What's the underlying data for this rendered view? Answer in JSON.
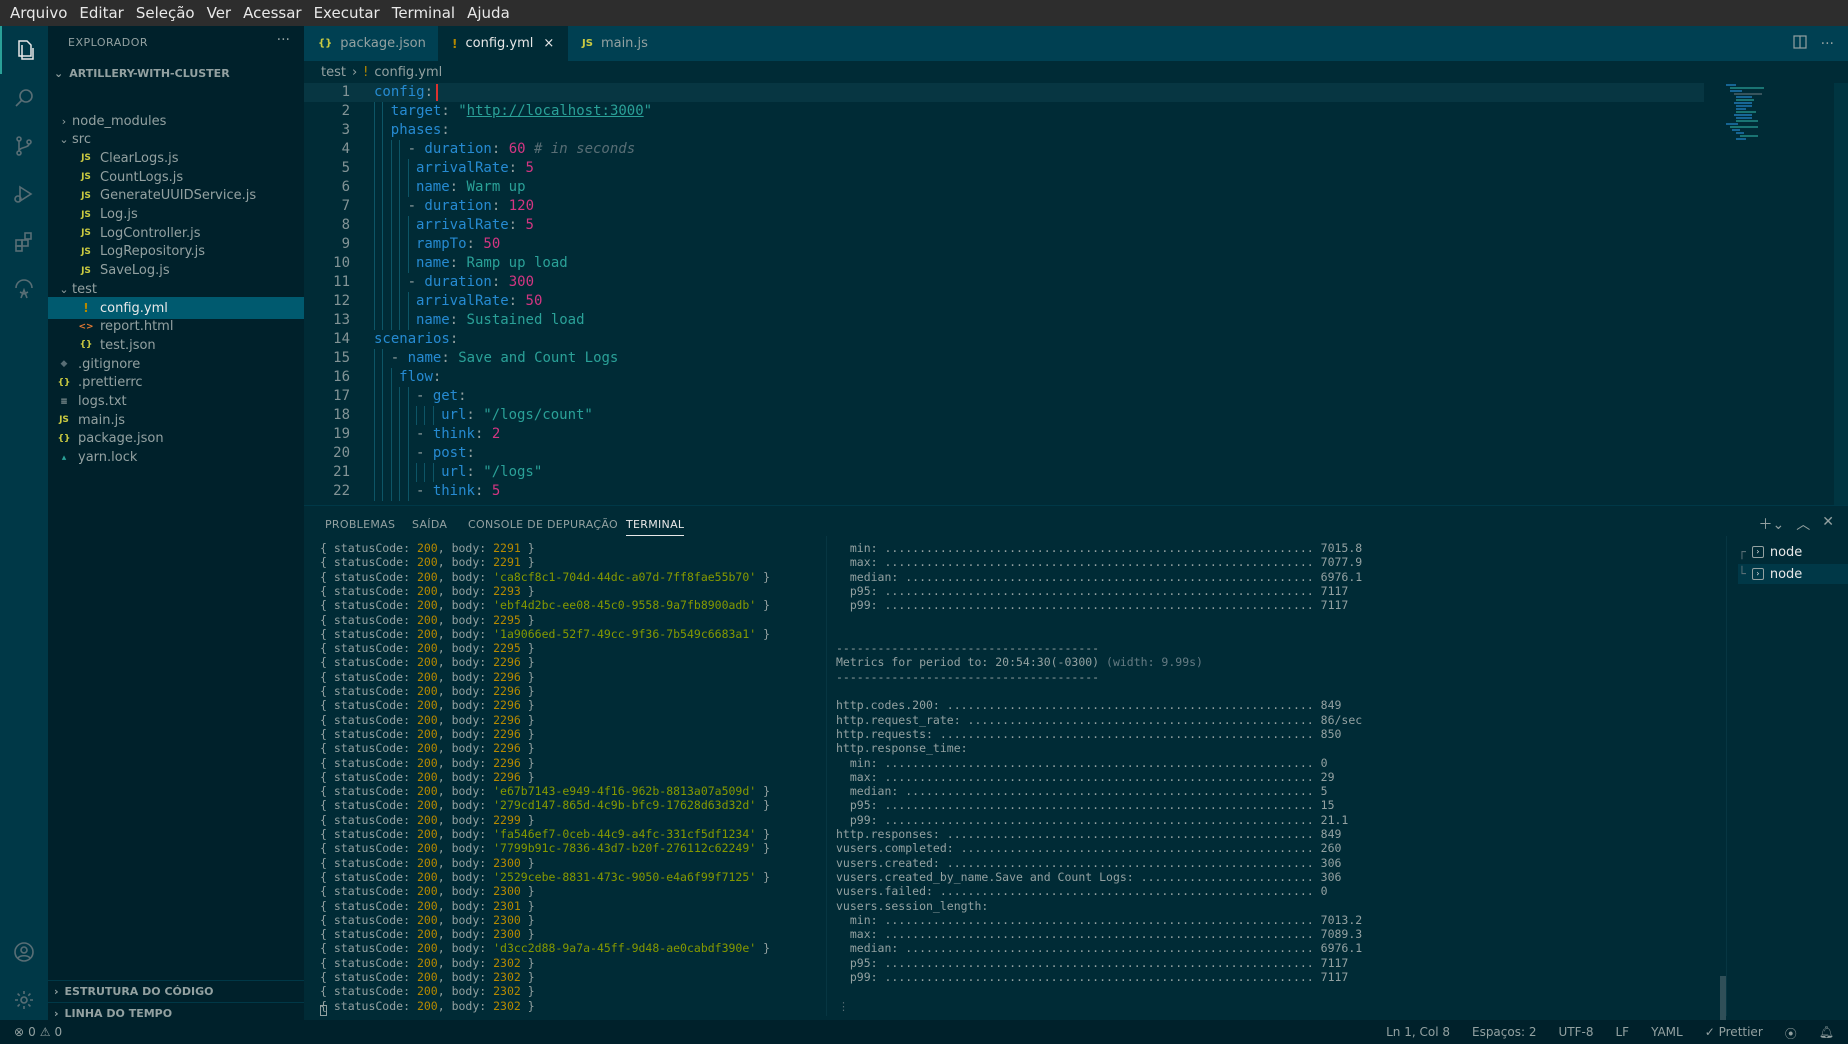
{
  "menu": [
    "Arquivo",
    "Editar",
    "Seleção",
    "Ver",
    "Acessar",
    "Executar",
    "Terminal",
    "Ajuda"
  ],
  "sidebar": {
    "title": "EXPLORADOR",
    "more": "···",
    "project": "ARTILLERY-WITH-CLUSTER",
    "tree": [
      {
        "label": "node_modules",
        "chev": "›",
        "icon": "",
        "cls": "",
        "indent": 1
      },
      {
        "label": "src",
        "chev": "⌄",
        "icon": "",
        "cls": "",
        "indent": 1
      },
      {
        "label": "ClearLogs.js",
        "chev": "",
        "icon": "JS",
        "cls": "fi-js",
        "indent": 2
      },
      {
        "label": "CountLogs.js",
        "chev": "",
        "icon": "JS",
        "cls": "fi-js",
        "indent": 2
      },
      {
        "label": "GenerateUUIDService.js",
        "chev": "",
        "icon": "JS",
        "cls": "fi-js",
        "indent": 2
      },
      {
        "label": "Log.js",
        "chev": "",
        "icon": "JS",
        "cls": "fi-js",
        "indent": 2
      },
      {
        "label": "LogController.js",
        "chev": "",
        "icon": "JS",
        "cls": "fi-js",
        "indent": 2
      },
      {
        "label": "LogRepository.js",
        "chev": "",
        "icon": "JS",
        "cls": "fi-js",
        "indent": 2
      },
      {
        "label": "SaveLog.js",
        "chev": "",
        "icon": "JS",
        "cls": "fi-js",
        "indent": 2
      },
      {
        "label": "test",
        "chev": "⌄",
        "icon": "",
        "cls": "",
        "indent": 1
      },
      {
        "label": "config.yml",
        "chev": "",
        "icon": "!",
        "cls": "fi-yml",
        "indent": 2,
        "selected": true
      },
      {
        "label": "report.html",
        "chev": "",
        "icon": "<>",
        "cls": "fi-html",
        "indent": 2
      },
      {
        "label": "test.json",
        "chev": "",
        "icon": "{}",
        "cls": "fi-json",
        "indent": 2
      },
      {
        "label": ".gitignore",
        "chev": "",
        "icon": "◆",
        "cls": "fi-git",
        "indent": 1
      },
      {
        "label": ".prettierrc",
        "chev": "",
        "icon": "{}",
        "cls": "fi-json",
        "indent": 1
      },
      {
        "label": "logs.txt",
        "chev": "",
        "icon": "≡",
        "cls": "fi-txt",
        "indent": 1
      },
      {
        "label": "main.js",
        "chev": "",
        "icon": "JS",
        "cls": "fi-js",
        "indent": 1
      },
      {
        "label": "package.json",
        "chev": "",
        "icon": "{}",
        "cls": "fi-json",
        "indent": 1
      },
      {
        "label": "yarn.lock",
        "chev": "",
        "icon": "▴",
        "cls": "fi-lock",
        "indent": 1
      }
    ],
    "sections": [
      "ESTRUTURA DO CÓDIGO",
      "LINHA DO TEMPO"
    ]
  },
  "tabs": [
    {
      "label": "package.json",
      "icon": "{}",
      "active": false
    },
    {
      "label": "config.yml",
      "icon": "!",
      "active": true,
      "close": "×"
    },
    {
      "label": "main.js",
      "icon": "JS",
      "active": false
    }
  ],
  "breadcrumb": {
    "folder": "test",
    "sep": "›",
    "icon": "!",
    "file": "config.yml"
  },
  "editor": {
    "lines": [
      {
        "n": "1",
        "indent": 0,
        "parts": [
          [
            "k-key",
            "config"
          ],
          [
            "k-pun",
            ":"
          ]
        ]
      },
      {
        "n": "2",
        "indent": 1,
        "parts": [
          [
            "k-key",
            "target"
          ],
          [
            "k-pun",
            ": "
          ],
          [
            "k-str",
            "\""
          ],
          [
            "k-str k-url",
            "http://localhost:3000"
          ],
          [
            "k-str",
            "\""
          ]
        ]
      },
      {
        "n": "3",
        "indent": 1,
        "parts": [
          [
            "k-key",
            "phases"
          ],
          [
            "k-pun",
            ":"
          ]
        ]
      },
      {
        "n": "4",
        "indent": 2,
        "parts": [
          [
            "k-pun",
            "- "
          ],
          [
            "k-key",
            "duration"
          ],
          [
            "k-pun",
            ": "
          ],
          [
            "k-num",
            "60"
          ],
          [
            "k-com",
            " # in seconds"
          ]
        ]
      },
      {
        "n": "5",
        "indent": 2.5,
        "parts": [
          [
            "k-key",
            "arrivalRate"
          ],
          [
            "k-pun",
            ": "
          ],
          [
            "k-num",
            "5"
          ]
        ]
      },
      {
        "n": "6",
        "indent": 2.5,
        "parts": [
          [
            "k-key",
            "name"
          ],
          [
            "k-pun",
            ": "
          ],
          [
            "k-txt",
            "Warm up"
          ]
        ]
      },
      {
        "n": "7",
        "indent": 2,
        "parts": [
          [
            "k-pun",
            "- "
          ],
          [
            "k-key",
            "duration"
          ],
          [
            "k-pun",
            ": "
          ],
          [
            "k-num",
            "120"
          ]
        ]
      },
      {
        "n": "8",
        "indent": 2.5,
        "parts": [
          [
            "k-key",
            "arrivalRate"
          ],
          [
            "k-pun",
            ": "
          ],
          [
            "k-num",
            "5"
          ]
        ]
      },
      {
        "n": "9",
        "indent": 2.5,
        "parts": [
          [
            "k-key",
            "rampTo"
          ],
          [
            "k-pun",
            ": "
          ],
          [
            "k-num",
            "50"
          ]
        ]
      },
      {
        "n": "10",
        "indent": 2.5,
        "parts": [
          [
            "k-key",
            "name"
          ],
          [
            "k-pun",
            ": "
          ],
          [
            "k-txt",
            "Ramp up load"
          ]
        ]
      },
      {
        "n": "11",
        "indent": 2,
        "parts": [
          [
            "k-pun",
            "- "
          ],
          [
            "k-key",
            "duration"
          ],
          [
            "k-pun",
            ": "
          ],
          [
            "k-num",
            "300"
          ]
        ]
      },
      {
        "n": "12",
        "indent": 2.5,
        "parts": [
          [
            "k-key",
            "arrivalRate"
          ],
          [
            "k-pun",
            ": "
          ],
          [
            "k-num",
            "50"
          ]
        ]
      },
      {
        "n": "13",
        "indent": 2.5,
        "parts": [
          [
            "k-key",
            "name"
          ],
          [
            "k-pun",
            ": "
          ],
          [
            "k-txt",
            "Sustained load"
          ]
        ]
      },
      {
        "n": "14",
        "indent": 0,
        "parts": [
          [
            "k-key",
            "scenarios"
          ],
          [
            "k-pun",
            ":"
          ]
        ]
      },
      {
        "n": "15",
        "indent": 1,
        "parts": [
          [
            "k-pun",
            "- "
          ],
          [
            "k-key",
            "name"
          ],
          [
            "k-pun",
            ": "
          ],
          [
            "k-txt",
            "Save and Count Logs"
          ]
        ]
      },
      {
        "n": "16",
        "indent": 1.5,
        "parts": [
          [
            "k-key",
            "flow"
          ],
          [
            "k-pun",
            ":"
          ]
        ]
      },
      {
        "n": "17",
        "indent": 2.5,
        "parts": [
          [
            "k-pun",
            "- "
          ],
          [
            "k-key",
            "get"
          ],
          [
            "k-pun",
            ":"
          ]
        ]
      },
      {
        "n": "18",
        "indent": 4,
        "parts": [
          [
            "k-key",
            "url"
          ],
          [
            "k-pun",
            ": "
          ],
          [
            "k-str",
            "\"/logs/count\""
          ]
        ]
      },
      {
        "n": "19",
        "indent": 2.5,
        "parts": [
          [
            "k-pun",
            "- "
          ],
          [
            "k-key",
            "think"
          ],
          [
            "k-pun",
            ": "
          ],
          [
            "k-num",
            "2"
          ]
        ]
      },
      {
        "n": "20",
        "indent": 2.5,
        "parts": [
          [
            "k-pun",
            "- "
          ],
          [
            "k-key",
            "post"
          ],
          [
            "k-pun",
            ":"
          ]
        ]
      },
      {
        "n": "21",
        "indent": 4,
        "parts": [
          [
            "k-key",
            "url"
          ],
          [
            "k-pun",
            ": "
          ],
          [
            "k-str",
            "\"/logs\""
          ]
        ]
      },
      {
        "n": "22",
        "indent": 2.5,
        "parts": [
          [
            "k-pun",
            "- "
          ],
          [
            "k-key",
            "think"
          ],
          [
            "k-pun",
            ": "
          ],
          [
            "k-num",
            "5"
          ]
        ]
      }
    ]
  },
  "panel": {
    "tabs": [
      "PROBLEMAS",
      "SAÍDA",
      "CONSOLE DE DEPURAÇÃO",
      "TERMINAL"
    ],
    "active_tab": "TERMINAL",
    "left_terminal": [
      [
        "2291",
        false
      ],
      [
        "2291",
        false
      ],
      [
        "'ca8cf8c1-704d-44dc-a07d-7ff8fae55b70'",
        true
      ],
      [
        "2293",
        false
      ],
      [
        "'ebf4d2bc-ee08-45c0-9558-9a7fb8900adb'",
        true
      ],
      [
        "2295",
        false
      ],
      [
        "'1a9066ed-52f7-49cc-9f36-7b549c6683a1'",
        true
      ],
      [
        "2295",
        false
      ],
      [
        "2296",
        false
      ],
      [
        "2296",
        false
      ],
      [
        "2296",
        false
      ],
      [
        "2296",
        false
      ],
      [
        "2296",
        false
      ],
      [
        "2296",
        false
      ],
      [
        "2296",
        false
      ],
      [
        "2296",
        false
      ],
      [
        "2296",
        false
      ],
      [
        "'e67b7143-e949-4f16-962b-8813a07a509d'",
        true
      ],
      [
        "'279cd147-865d-4c9b-bfc9-17628d63d32d'",
        true
      ],
      [
        "2299",
        false
      ],
      [
        "'fa546ef7-0ceb-44c9-a4fc-331cf5df1234'",
        true
      ],
      [
        "'7799b91c-7836-43d7-b20f-276112c62249'",
        true
      ],
      [
        "2300",
        false
      ],
      [
        "'2529cebe-8831-473c-9050-e4a6f99f7125'",
        true
      ],
      [
        "2300",
        false
      ],
      [
        "2301",
        false
      ],
      [
        "2300",
        false
      ],
      [
        "2300",
        false
      ],
      [
        "'d3cc2d88-9a7a-45ff-9d48-ae0cabdf390e'",
        true
      ],
      [
        "2302",
        false
      ],
      [
        "2302",
        false
      ],
      [
        "2302",
        false
      ],
      [
        "2302",
        false
      ]
    ],
    "status_code": "200",
    "right_terminal": [
      {
        "label": "  min:",
        "value": "7015.8"
      },
      {
        "label": "  max:",
        "value": "7077.9"
      },
      {
        "label": "  median:",
        "value": "6976.1"
      },
      {
        "label": "  p95:",
        "value": "7117"
      },
      {
        "label": "  p99:",
        "value": "7117"
      },
      {
        "raw": ""
      },
      {
        "raw": ""
      },
      {
        "raw": "--------------------------------------"
      },
      {
        "raw": "Metrics for period to: 20:54:30(-0300)",
        "dim": " (width: 9.99s)"
      },
      {
        "raw": "--------------------------------------"
      },
      {
        "raw": ""
      },
      {
        "label": "http.codes.200:",
        "value": "849"
      },
      {
        "label": "http.request_rate:",
        "value": "86/sec"
      },
      {
        "label": "http.requests:",
        "value": "850"
      },
      {
        "raw": "http.response_time:"
      },
      {
        "label": "  min:",
        "value": "0"
      },
      {
        "label": "  max:",
        "value": "29"
      },
      {
        "label": "  median:",
        "value": "5"
      },
      {
        "label": "  p95:",
        "value": "15"
      },
      {
        "label": "  p99:",
        "value": "21.1"
      },
      {
        "label": "http.responses:",
        "value": "849"
      },
      {
        "label": "vusers.completed:",
        "value": "260"
      },
      {
        "label": "vusers.created:",
        "value": "306"
      },
      {
        "label": "vusers.created_by_name.Save and Count Logs:",
        "value": "306"
      },
      {
        "label": "vusers.failed:",
        "value": "0"
      },
      {
        "raw": "vusers.session_length:"
      },
      {
        "label": "  min:",
        "value": "7013.2"
      },
      {
        "label": "  max:",
        "value": "7089.3"
      },
      {
        "label": "  median:",
        "value": "6976.1"
      },
      {
        "label": "  p95:",
        "value": "7117"
      },
      {
        "label": "  p99:",
        "value": "7117"
      }
    ],
    "terminals": [
      "node",
      "node"
    ]
  },
  "status": {
    "errors": "0",
    "warnings": "0",
    "position": "Ln 1, Col 8",
    "spaces": "Espaços: 2",
    "encoding": "UTF-8",
    "eol": "LF",
    "language": "YAML",
    "formatter": "Prettier"
  },
  "colors": {
    "accent": "#2aa198",
    "editor_bg": "#002b36",
    "sidebar_bg": "#00212b"
  }
}
